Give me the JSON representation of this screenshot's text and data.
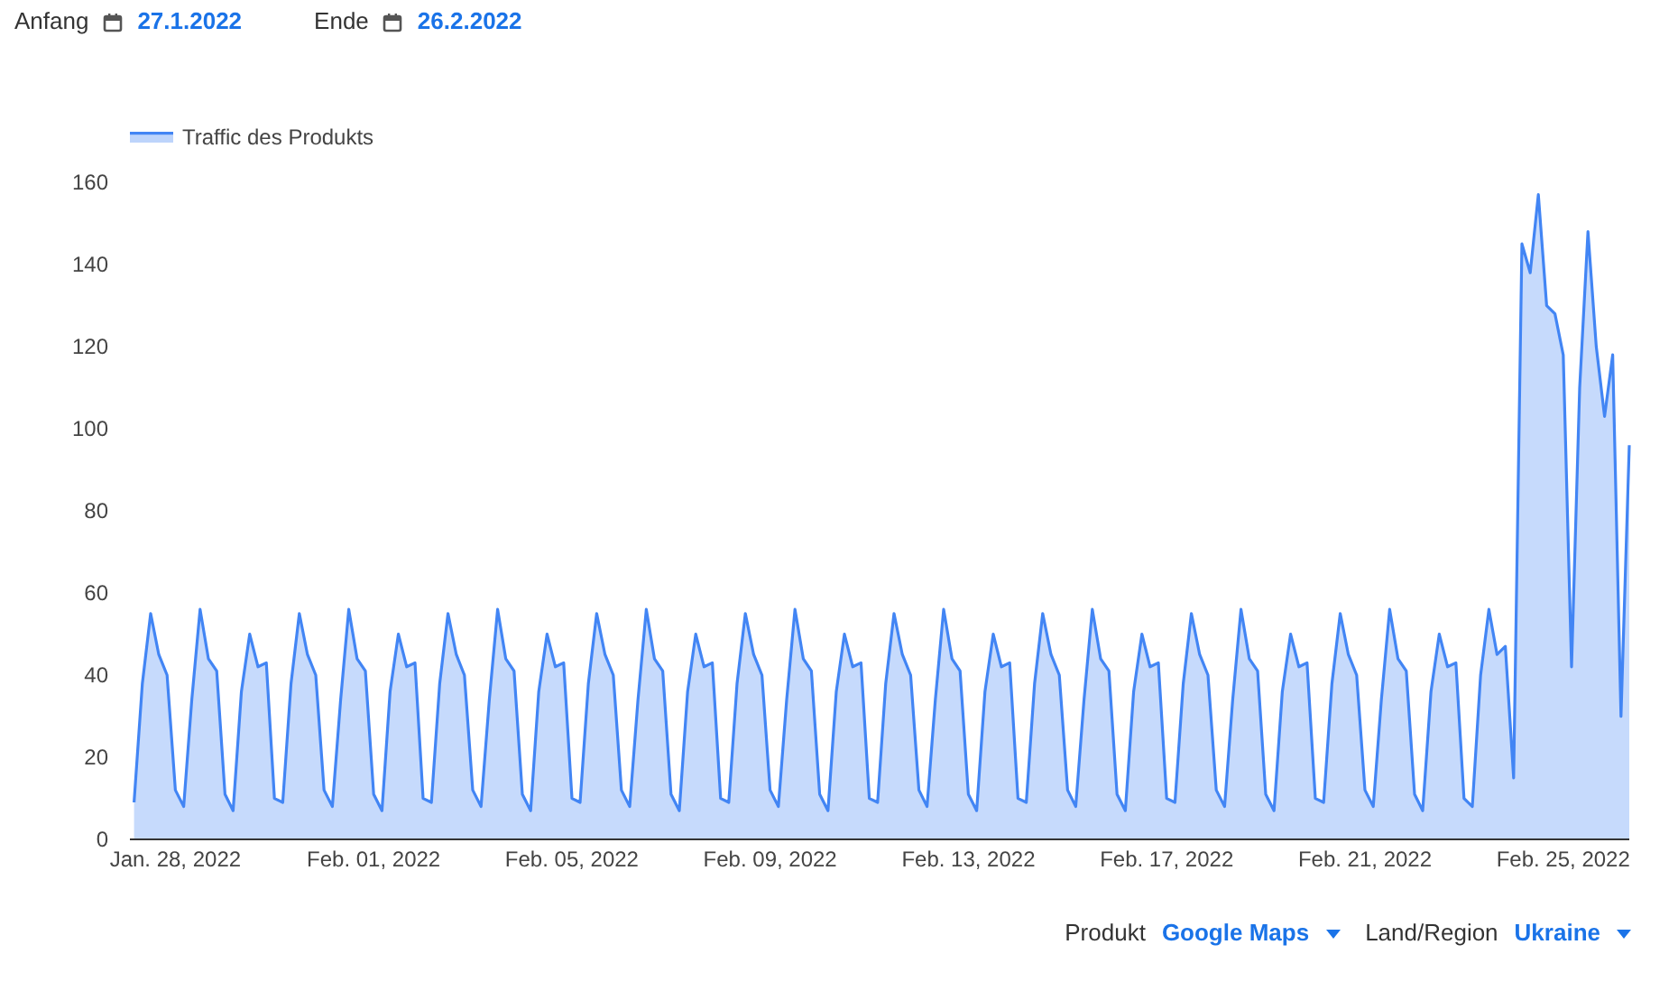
{
  "date_range": {
    "start_label": "Anfang",
    "start_value": "27.1.2022",
    "end_label": "Ende",
    "end_value": "26.2.2022"
  },
  "chart": {
    "chart_data": {
      "type": "area",
      "ylim": [
        0,
        160
      ],
      "categories": [
        null,
        null,
        null,
        null,
        null,
        "Jan. 28, 2022",
        null,
        null,
        null,
        null,
        null,
        null,
        null,
        null,
        null,
        null,
        null,
        null,
        null,
        null,
        null,
        null,
        null,
        null,
        null,
        null,
        null,
        null,
        null,
        "Feb. 01, 2022",
        null,
        null,
        null,
        null,
        null,
        null,
        null,
        null,
        null,
        null,
        null,
        null,
        null,
        null,
        null,
        null,
        null,
        null,
        null,
        null,
        null,
        null,
        null,
        "Feb. 05, 2022",
        null,
        null,
        null,
        null,
        null,
        null,
        null,
        null,
        null,
        null,
        null,
        null,
        null,
        null,
        null,
        null,
        null,
        null,
        null,
        null,
        null,
        null,
        null,
        "Feb. 09, 2022",
        null,
        null,
        null,
        null,
        null,
        null,
        null,
        null,
        null,
        null,
        null,
        null,
        null,
        null,
        null,
        null,
        null,
        null,
        null,
        null,
        null,
        null,
        null,
        "Feb. 13, 2022",
        null,
        null,
        null,
        null,
        null,
        null,
        null,
        null,
        null,
        null,
        null,
        null,
        null,
        null,
        null,
        null,
        null,
        null,
        null,
        null,
        null,
        null,
        null,
        "Feb. 17, 2022",
        null,
        null,
        null,
        null,
        null,
        null,
        null,
        null,
        null,
        null,
        null,
        null,
        null,
        null,
        null,
        null,
        null,
        null,
        null,
        null,
        null,
        null,
        null,
        "Feb. 21, 2022",
        null,
        null,
        null,
        null,
        null,
        null,
        null,
        null,
        null,
        null,
        null,
        null,
        null,
        null,
        null,
        null,
        null,
        null,
        null,
        null,
        null,
        null,
        null,
        "Feb. 25, 2022",
        null,
        null,
        null,
        null,
        null,
        null,
        null,
        null
      ],
      "yticks": [
        0,
        20,
        40,
        60,
        80,
        100,
        120,
        140,
        160
      ],
      "series": [
        {
          "name": "Traffic des Produkts",
          "color": "#4285f4",
          "values": [
            9,
            38,
            55,
            45,
            40,
            12,
            8,
            34,
            56,
            44,
            41,
            11,
            7,
            36,
            50,
            42,
            43,
            10,
            9,
            38,
            55,
            45,
            40,
            12,
            8,
            34,
            56,
            44,
            41,
            11,
            7,
            36,
            50,
            42,
            43,
            10,
            9,
            38,
            55,
            45,
            40,
            12,
            8,
            34,
            56,
            44,
            41,
            11,
            7,
            36,
            50,
            42,
            43,
            10,
            9,
            38,
            55,
            45,
            40,
            12,
            8,
            34,
            56,
            44,
            41,
            11,
            7,
            36,
            50,
            42,
            43,
            10,
            9,
            38,
            55,
            45,
            40,
            12,
            8,
            34,
            56,
            44,
            41,
            11,
            7,
            36,
            50,
            42,
            43,
            10,
            9,
            38,
            55,
            45,
            40,
            12,
            8,
            34,
            56,
            44,
            41,
            11,
            7,
            36,
            50,
            42,
            43,
            10,
            9,
            38,
            55,
            45,
            40,
            12,
            8,
            34,
            56,
            44,
            41,
            11,
            7,
            36,
            50,
            42,
            43,
            10,
            9,
            38,
            55,
            45,
            40,
            12,
            8,
            34,
            56,
            44,
            41,
            11,
            7,
            36,
            50,
            42,
            43,
            10,
            9,
            38,
            55,
            45,
            40,
            12,
            8,
            34,
            56,
            44,
            41,
            11,
            7,
            36,
            50,
            42,
            43,
            10,
            8,
            40,
            56,
            45,
            47,
            15,
            145,
            138,
            157,
            130,
            128,
            118,
            42,
            110,
            148,
            120,
            103,
            118,
            30,
            96
          ]
        }
      ]
    }
  },
  "filters": [
    {
      "label": "Produkt",
      "value": "Google Maps"
    },
    {
      "label": "Land/Region",
      "value": "Ukraine"
    }
  ]
}
